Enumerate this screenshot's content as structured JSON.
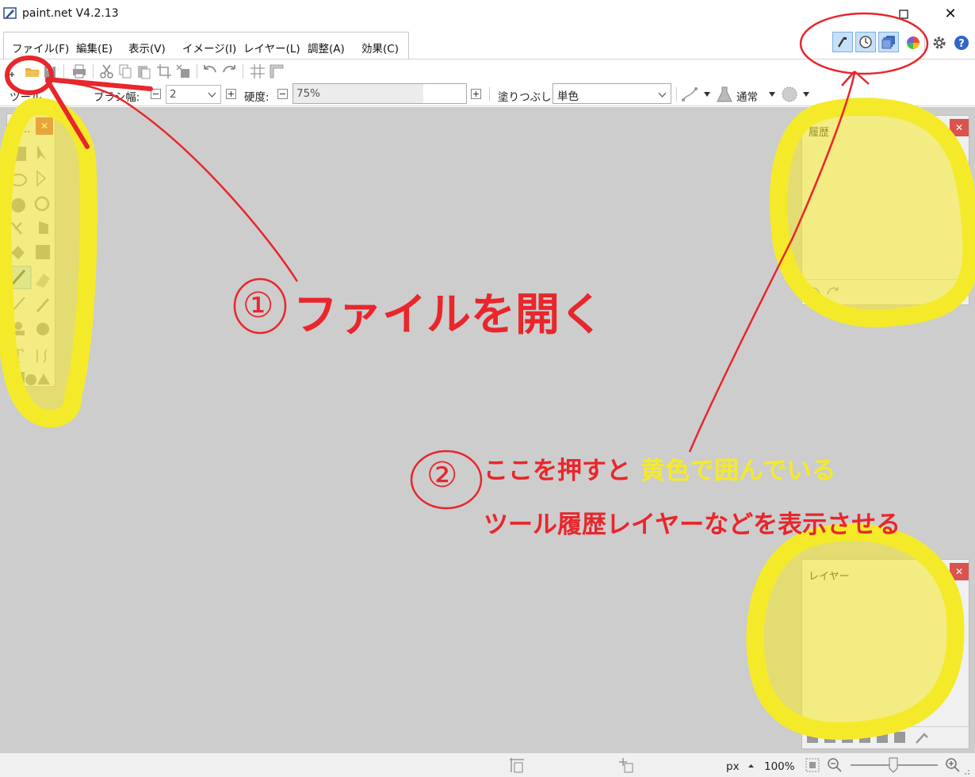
{
  "window": {
    "title": "paint.net V4.2.13"
  },
  "menu": [
    "ファイル(F)",
    "編集(E)",
    "表示(V)",
    "イメージ(I)",
    "レイヤー(L)",
    "調整(A)",
    "効果(C)"
  ],
  "panel_toggles": [
    "hammer-icon",
    "clock-icon",
    "layers-icon"
  ],
  "toolbar2": {
    "tool_label": "ツール",
    "brush_width_label": "ブラシ幅:",
    "brush_width_value": "2",
    "hardness_label": "硬度:",
    "hardness_value": "75%",
    "hardness_fraction": 0.75,
    "fill_label": "塗りつぶし:",
    "fill_value": "単色",
    "blend_value": "通常"
  },
  "panels": {
    "tools_title": "ツ...",
    "history_title": "履歴",
    "layers_title": "レイヤー"
  },
  "status": {
    "unit": "px",
    "zoom": "100%"
  },
  "annotations": {
    "step1_number": "①",
    "step1_text": "ファイルを開く",
    "step2_number": "②",
    "step2_text_a": "ここを押すと",
    "step2_text_b": "黄色で囲んでいる",
    "step2_text_c": "ツール履歴レイヤーなどを表示させる"
  },
  "colors": {
    "annotation_red": "#e8262b",
    "annotation_yellow": "#f5ea2a",
    "toggle_active": "#c6e0f8",
    "canvas_bg": "#cdcdcd"
  }
}
